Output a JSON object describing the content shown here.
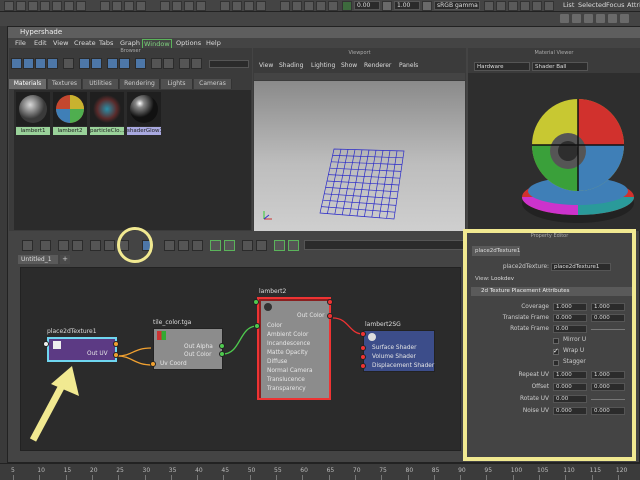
{
  "topbar": {
    "field1": "0.00",
    "field2": "1.00",
    "colorspace": "sRGB gamma",
    "right_menus": [
      "List",
      "Selected",
      "Focus",
      "Attributes"
    ]
  },
  "window": {
    "title": "Hypershade",
    "menus": [
      "File",
      "Edit",
      "View",
      "Create",
      "Tabs",
      "Graph",
      "Window",
      "Options",
      "Help"
    ]
  },
  "browser": {
    "title": "Browser",
    "tabs": [
      "Materials",
      "Textures",
      "Utilities",
      "Rendering",
      "Lights",
      "Cameras"
    ],
    "swatches": [
      {
        "label": "lambert1",
        "color": "#9ad29a"
      },
      {
        "label": "lambert2",
        "color": "#9ad29a"
      },
      {
        "label": "particleClo...",
        "color": "#9ad29a"
      },
      {
        "label": "shaderGlow1",
        "color": "#a9a9e0"
      }
    ]
  },
  "viewport": {
    "title": "Viewport",
    "menus": [
      "View",
      "Shading",
      "Lighting",
      "Show",
      "Renderer",
      "Panels"
    ]
  },
  "material_viewer": {
    "title": "Material Viewer",
    "renderer": "Hardware",
    "preview": "Shader Ball"
  },
  "graph": {
    "tab_label": "Untitled_1",
    "tab_add": "+",
    "nodes": {
      "place2d": {
        "title": "place2dTexture1",
        "out_uv": "Out UV"
      },
      "tile": {
        "title": "tile_color.tga",
        "out_alpha": "Out Alpha",
        "out_color": "Out Color",
        "uv_coord": "Uv Coord"
      },
      "lambert": {
        "title": "lambert2",
        "out_color": "Out Color",
        "inputs": [
          "Color",
          "Ambient Color",
          "Incandescence",
          "Matte Opacity",
          "Diffuse",
          "Normal Camera",
          "Translucence",
          "Transparency"
        ]
      },
      "sg": {
        "title": "lambert2SG",
        "inputs": [
          "Surface Shader",
          "Volume Shader",
          "Displacement Shader"
        ]
      }
    }
  },
  "property_editor": {
    "title": "Property Editor",
    "tab": "place2dTexture1",
    "node_label": "place2dTexture:",
    "node_value": "place2dTexture1",
    "view_label": "View:",
    "view_value": "Lookdev",
    "section": "2d Texture Placement Attributes",
    "rows": [
      {
        "label": "Coverage",
        "v1": "1.000",
        "v2": "1.000"
      },
      {
        "label": "Translate Frame",
        "v1": "0.000",
        "v2": "0.000"
      },
      {
        "label": "Rotate Frame",
        "v1": "0.00",
        "v2": ""
      },
      {
        "label": "Repeat UV",
        "v1": "1.000",
        "v2": "1.000"
      },
      {
        "label": "Offset",
        "v1": "0.000",
        "v2": "0.000"
      },
      {
        "label": "Rotate UV",
        "v1": "0.00",
        "v2": ""
      },
      {
        "label": "Noise UV",
        "v1": "0.000",
        "v2": "0.000"
      }
    ],
    "checks": [
      {
        "label": "Mirror U",
        "checked": false
      },
      {
        "label": "Wrap U",
        "checked": true
      },
      {
        "label": "Stagger",
        "checked": false
      }
    ]
  },
  "timeline": {
    "ticks": [
      "5",
      "10",
      "15",
      "20",
      "25",
      "30",
      "35",
      "40",
      "45",
      "50",
      "55",
      "60",
      "65",
      "70",
      "75",
      "80",
      "85",
      "90",
      "95",
      "100",
      "105",
      "110",
      "115",
      "120"
    ]
  }
}
